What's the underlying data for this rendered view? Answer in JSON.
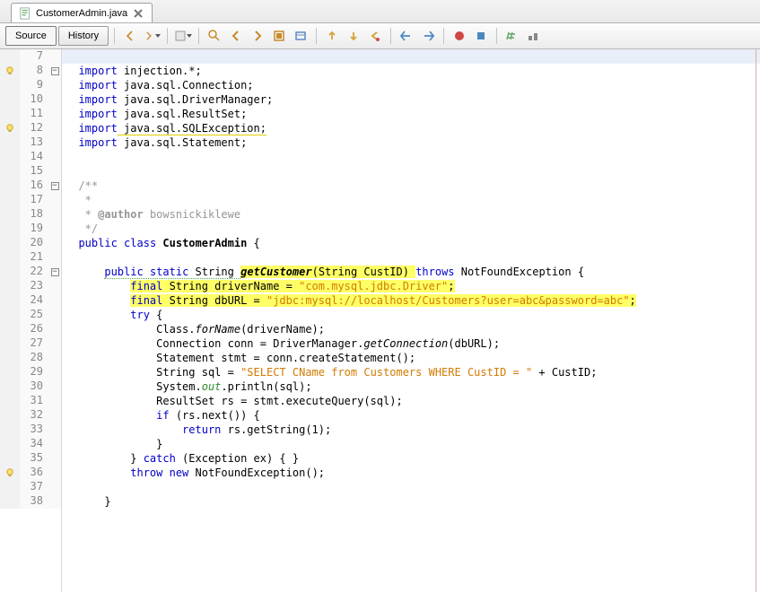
{
  "tab": {
    "label": "CustomerAdmin.java"
  },
  "toolbar": {
    "source": "Source",
    "history": "History"
  },
  "gutter": [
    {
      "ln": 7,
      "icon": "",
      "fold": ""
    },
    {
      "ln": 8,
      "icon": "bulb",
      "fold": "minus"
    },
    {
      "ln": 9,
      "icon": "",
      "fold": ""
    },
    {
      "ln": 10,
      "icon": "",
      "fold": ""
    },
    {
      "ln": 11,
      "icon": "",
      "fold": ""
    },
    {
      "ln": 12,
      "icon": "bulb",
      "fold": ""
    },
    {
      "ln": 13,
      "icon": "",
      "fold": ""
    },
    {
      "ln": 14,
      "icon": "",
      "fold": ""
    },
    {
      "ln": 15,
      "icon": "",
      "fold": ""
    },
    {
      "ln": 16,
      "icon": "",
      "fold": "minus"
    },
    {
      "ln": 17,
      "icon": "",
      "fold": ""
    },
    {
      "ln": 18,
      "icon": "",
      "fold": ""
    },
    {
      "ln": 19,
      "icon": "",
      "fold": ""
    },
    {
      "ln": 20,
      "icon": "",
      "fold": ""
    },
    {
      "ln": 21,
      "icon": "",
      "fold": ""
    },
    {
      "ln": 22,
      "icon": "",
      "fold": "minus"
    },
    {
      "ln": 23,
      "icon": "",
      "fold": ""
    },
    {
      "ln": 24,
      "icon": "",
      "fold": ""
    },
    {
      "ln": 25,
      "icon": "",
      "fold": ""
    },
    {
      "ln": 26,
      "icon": "",
      "fold": ""
    },
    {
      "ln": 27,
      "icon": "",
      "fold": ""
    },
    {
      "ln": 28,
      "icon": "",
      "fold": ""
    },
    {
      "ln": 29,
      "icon": "",
      "fold": ""
    },
    {
      "ln": 30,
      "icon": "",
      "fold": ""
    },
    {
      "ln": 31,
      "icon": "",
      "fold": ""
    },
    {
      "ln": 32,
      "icon": "",
      "fold": ""
    },
    {
      "ln": 33,
      "icon": "",
      "fold": ""
    },
    {
      "ln": 34,
      "icon": "",
      "fold": ""
    },
    {
      "ln": 35,
      "icon": "",
      "fold": ""
    },
    {
      "ln": 36,
      "icon": "bulb",
      "fold": ""
    },
    {
      "ln": 37,
      "icon": "",
      "fold": ""
    },
    {
      "ln": 38,
      "icon": "",
      "fold": ""
    }
  ],
  "code": {
    "l7": "",
    "l8a": "import",
    "l8b": " injection.*;",
    "l9a": "import",
    "l9b": " java.sql.Connection;",
    "l10a": "import",
    "l10b": " java.sql.DriverManager;",
    "l11a": "import",
    "l11b": " java.sql.ResultSet;",
    "l12a": "import",
    "l12b": " java.sql.SQLException;",
    "l13a": "import",
    "l13b": " java.sql.Statement;",
    "l16": "/**",
    "l17": " *",
    "l18a": " * ",
    "l18b": "@author",
    "l18c": " bowsnickiklewe",
    "l19": " */",
    "l20a": "public",
    "l20b": " ",
    "l20c": "class",
    "l20d": " ",
    "l20e": "CustomerAdmin",
    "l20f": " {",
    "l22a": "    ",
    "l22b": "public",
    "l22c": " ",
    "l22d": "static",
    "l22e": " String ",
    "l22f": "getCustomer",
    "l22g": "(String CustID) ",
    "l22h": "throws",
    "l22i": " NotFoundException {",
    "l23a": "        ",
    "l23b": "final",
    "l23c": " String driverName = ",
    "l23d": "\"com.mysql.jdbc.Driver\"",
    "l23e": ";",
    "l24a": "        ",
    "l24b": "final",
    "l24c": " String dbURL = ",
    "l24d": "\"jdbc:mysql://localhost/Customers?user=abc&password=abc\"",
    "l24e": ";",
    "l25a": "        ",
    "l25b": "try",
    "l25c": " {",
    "l26a": "            Class.",
    "l26b": "forName",
    "l26c": "(driverName);",
    "l27a": "            Connection conn = DriverManager.",
    "l27b": "getConnection",
    "l27c": "(dbURL);",
    "l28": "            Statement stmt = conn.createStatement();",
    "l29a": "            String sql = ",
    "l29b": "\"SELECT CName from Customers WHERE CustID = \"",
    "l29c": " + CustID;",
    "l30a": "            System.",
    "l30b": "out",
    "l30c": ".println(sql);",
    "l31": "            ResultSet rs = stmt.executeQuery(sql);",
    "l32a": "            ",
    "l32b": "if",
    "l32c": " (rs.next()) {",
    "l33a": "                ",
    "l33b": "return",
    "l33c": " rs.getString(1);",
    "l34": "            }",
    "l35a": "        } ",
    "l35b": "catch",
    "l35c": " (Exception ex) { }",
    "l36a": "        ",
    "l36b": "throw",
    "l36c": " ",
    "l36d": "new",
    "l36e": " NotFoundException();",
    "l38": "    }"
  },
  "marginCol": 773
}
